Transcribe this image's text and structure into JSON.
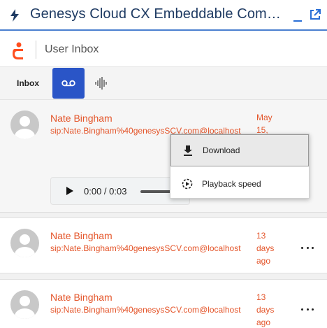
{
  "window": {
    "title": "Genesys Cloud CX Embeddable Components",
    "icons": [
      "bolt-icon",
      "minimize-icon",
      "external-link-icon"
    ]
  },
  "header": {
    "title": "User Inbox",
    "logo": "genesys-logo"
  },
  "tabs": [
    {
      "label": "Inbox",
      "active": false
    },
    {
      "label": "",
      "icon": "voicemail-icon",
      "active": true
    },
    {
      "label": "",
      "icon": "audio-waveform-icon",
      "active": false
    }
  ],
  "messages": [
    {
      "name": "Nate Bingham",
      "address": "sip:Nate.Bingham%40genesysSCV.com@localhost",
      "date": "May 15,",
      "expanded": true,
      "player": {
        "time": "0:00 / 0:03"
      }
    },
    {
      "name": "Nate Bingham",
      "address": "sip:Nate.Bingham%40genesysSCV.com@localhost",
      "date": "13 days ago",
      "expanded": false
    },
    {
      "name": "Nate Bingham",
      "address": "sip:Nate.Bingham%40genesysSCV.com@localhost",
      "date": "13 days ago",
      "expanded": false
    }
  ],
  "context_menu": {
    "items": [
      {
        "label": "Download",
        "icon": "download-icon",
        "highlighted": true
      },
      {
        "label": "Playback speed",
        "icon": "playback-speed-icon",
        "highlighted": false
      }
    ]
  },
  "colors": {
    "accent": "#2a55c7",
    "title_text": "#1f3b63",
    "contact_orange": "#e4552a",
    "logo_orange": "#ff4f1f"
  }
}
